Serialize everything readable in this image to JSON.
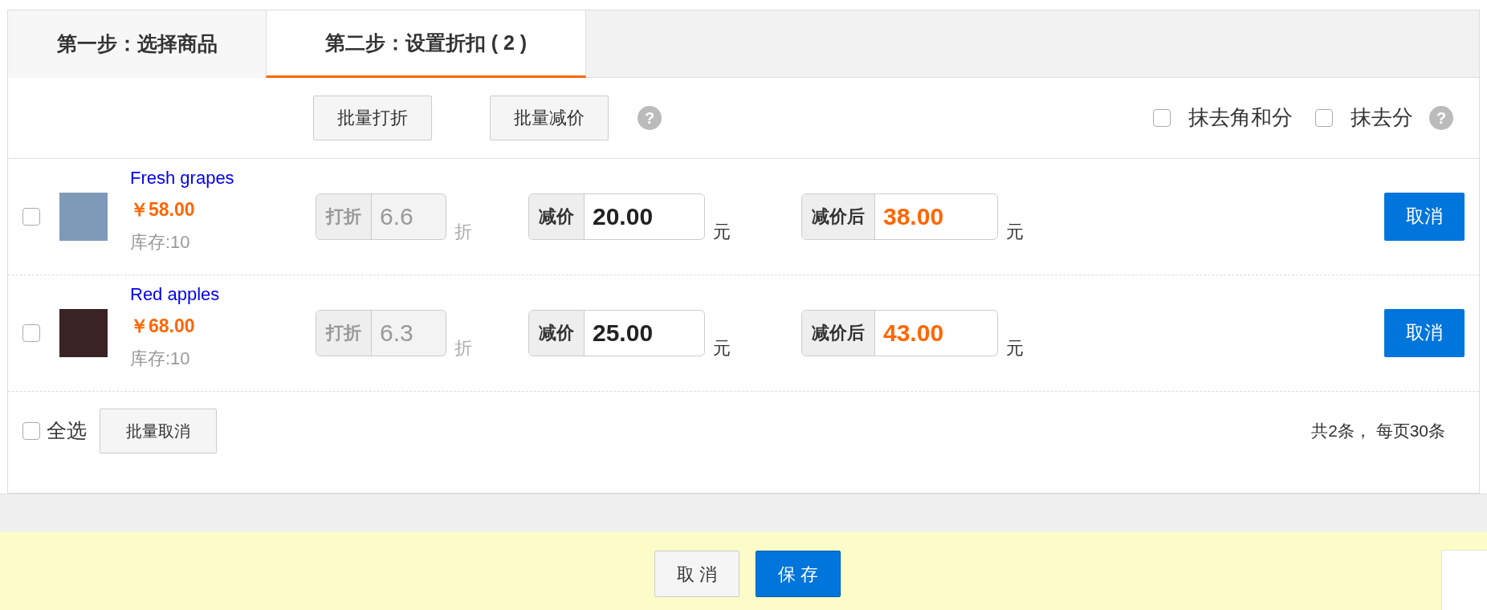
{
  "tabs": [
    {
      "label": "第一步：选择商品",
      "selected": false
    },
    {
      "label": "第二步：设置折扣 ( 2 )",
      "selected": true
    }
  ],
  "toolbar": {
    "buttons": [
      "批量打折",
      "批量减价"
    ],
    "help": "?",
    "options": [
      {
        "label": "抹去角和分",
        "checked": false
      },
      {
        "label": "抹去分",
        "checked": false
      }
    ],
    "options_help": "?"
  },
  "items": [
    {
      "checked": false,
      "kind": "grapes",
      "name": "Fresh grapes",
      "price": "￥58.00",
      "stock": "库存:10",
      "discount": {
        "label": "打折",
        "value": "6.6",
        "unit": "折",
        "disabled": true
      },
      "reduce": {
        "label": "减价",
        "value": "20.00",
        "unit": "元",
        "disabled": false
      },
      "after": {
        "label": "减价后",
        "value": "38.00",
        "unit": "元"
      },
      "cancel": "取消"
    },
    {
      "checked": false,
      "kind": "apples",
      "name": "Red apples",
      "price": "￥68.00",
      "stock": "库存:10",
      "discount": {
        "label": "打折",
        "value": "6.3",
        "unit": "折",
        "disabled": true
      },
      "reduce": {
        "label": "减价",
        "value": "25.00",
        "unit": "元",
        "disabled": false
      },
      "after": {
        "label": "减价后",
        "value": "43.00",
        "unit": "元"
      },
      "cancel": "取消"
    }
  ],
  "footer": {
    "select_all": {
      "label": "全选",
      "checked": false
    },
    "batch_cancel": "批量取消",
    "summary": "共2条， 每页30条"
  },
  "actions": [
    {
      "label": "取 消",
      "kind": "secondary"
    },
    {
      "label": "保 存",
      "kind": "primary"
    }
  ]
}
